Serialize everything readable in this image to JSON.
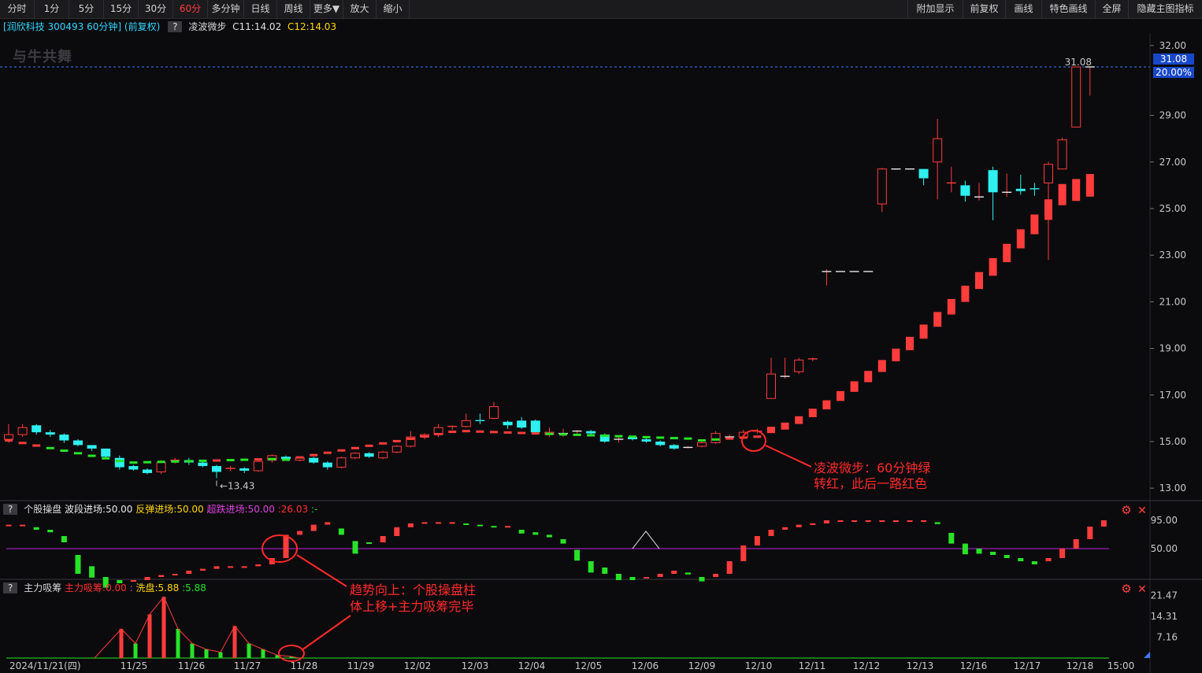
{
  "toolbar": {
    "left": [
      "分时",
      "1分",
      "5分",
      "15分",
      "30分",
      "60分",
      "多分钟",
      "日线",
      "周线",
      "更多▼",
      "放大",
      "缩小"
    ],
    "active": "60分",
    "right": [
      "附加显示",
      "前复权",
      "画线",
      "特色画线",
      "全屏",
      "隐藏主图指标"
    ]
  },
  "info": {
    "stock": "[润欣科技 300493 60分钟]",
    "adjust": "(前复权)",
    "q": "?",
    "indicator": "凌波微步",
    "c1": "C11:14.02",
    "c2": "C12:14.03"
  },
  "watermark": "与牛共舞",
  "panel2": {
    "q": "?",
    "name": "个股操盘",
    "v1": "波段进场:50.00",
    "v2": "反弹进场:50.00",
    "v3": "超跌进场:50.00",
    "v4": ":26.03",
    "v5": ":-"
  },
  "panel3": {
    "q": "?",
    "name": "主力吸筹",
    "v1": "主力吸筹:0.00",
    "v2": ":",
    "v3": "洗盘:5.88",
    "v4": ":5.88"
  },
  "annotations": {
    "a1_line1": "凌波微步：60分钟绿",
    "a1_line2": "转红，此后一路红色",
    "a2_line1": "趋势向上：个股操盘柱",
    "a2_line2": "体上移+主力吸筹完毕"
  },
  "price_tags": {
    "last": "31.08",
    "pct": "20.00%",
    "hi_label": "31.08",
    "lo_label": "13.43"
  },
  "colors": {
    "up": "#ff3c3c",
    "down": "#2ef0f0",
    "green": "#27e327",
    "purple": "#c020e0",
    "accent": "#ff2a2a"
  },
  "chart_data": {
    "type": "candlestick",
    "y_axis_main": [
      13.0,
      15.0,
      17.0,
      19.0,
      21.0,
      23.0,
      25.0,
      27.0,
      29.0,
      31.0,
      32.0
    ],
    "y_axis_labels_main": [
      "13.00",
      "15.00",
      "17.00",
      "19.00",
      "21.00",
      "23.00",
      "25.00",
      "27.00",
      "29.00",
      "32.00"
    ],
    "y_axis_osc": [
      "95.00",
      "50.00"
    ],
    "y_axis_vol": [
      "21.47",
      "14.31",
      "7.16"
    ],
    "x_labels": [
      "2024/11/21(四)",
      "11/25",
      "11/26",
      "11/27",
      "11/28",
      "11/29",
      "12/02",
      "12/03",
      "12/04",
      "12/05",
      "12/06",
      "12/09",
      "12/10",
      "12/11",
      "12/12",
      "12/13",
      "12/16",
      "12/17",
      "12/18",
      "15:00"
    ],
    "ohlc": [
      [
        15.1,
        15.3,
        15.75,
        14.95
      ],
      [
        15.3,
        15.6,
        15.75,
        15.2
      ],
      [
        15.7,
        15.4,
        15.75,
        15.3
      ],
      [
        15.4,
        15.3,
        15.5,
        15.2
      ],
      [
        15.3,
        15.05,
        15.35,
        14.95
      ],
      [
        15.05,
        14.85,
        15.1,
        14.8
      ],
      [
        14.85,
        14.7,
        14.85,
        14.6
      ],
      [
        14.7,
        14.35,
        14.7,
        14.3
      ],
      [
        14.3,
        13.9,
        14.4,
        13.8
      ],
      [
        13.95,
        13.8,
        14.0,
        13.75
      ],
      [
        13.8,
        13.65,
        13.85,
        13.6
      ],
      [
        13.7,
        14.1,
        14.2,
        13.6
      ],
      [
        14.15,
        14.2,
        14.3,
        14.05
      ],
      [
        14.2,
        14.1,
        14.3,
        14.0
      ],
      [
        14.1,
        13.95,
        14.2,
        13.9
      ],
      [
        13.95,
        13.7,
        14.0,
        13.43
      ],
      [
        13.8,
        13.85,
        13.95,
        13.75
      ],
      [
        13.85,
        13.75,
        13.9,
        13.65
      ],
      [
        13.75,
        14.15,
        14.2,
        13.7
      ],
      [
        14.2,
        14.4,
        14.45,
        14.1
      ],
      [
        14.35,
        14.25,
        14.4,
        14.2
      ],
      [
        14.2,
        14.3,
        14.35,
        14.15
      ],
      [
        14.3,
        14.1,
        14.35,
        14.05
      ],
      [
        14.1,
        13.9,
        14.15,
        13.8
      ],
      [
        13.9,
        14.3,
        14.35,
        13.85
      ],
      [
        14.3,
        14.5,
        14.55,
        14.25
      ],
      [
        14.5,
        14.35,
        14.55,
        14.3
      ],
      [
        14.3,
        14.55,
        14.6,
        14.25
      ],
      [
        14.55,
        14.8,
        14.85,
        14.5
      ],
      [
        14.8,
        15.2,
        15.45,
        14.75
      ],
      [
        15.2,
        15.3,
        15.35,
        15.1
      ],
      [
        15.3,
        15.6,
        15.75,
        15.2
      ],
      [
        15.6,
        15.65,
        15.7,
        15.5
      ],
      [
        15.65,
        15.9,
        16.2,
        15.6
      ],
      [
        15.9,
        15.85,
        16.2,
        15.75
      ],
      [
        16.0,
        16.5,
        16.7,
        15.95
      ],
      [
        15.85,
        15.7,
        15.9,
        15.55
      ],
      [
        15.9,
        15.6,
        16.05,
        15.55
      ],
      [
        15.9,
        15.4,
        15.95,
        15.35
      ],
      [
        15.3,
        15.4,
        15.6,
        15.2
      ],
      [
        15.35,
        15.35,
        15.55,
        15.2
      ],
      [
        15.45,
        15.45,
        15.5,
        15.35
      ],
      [
        15.45,
        15.35,
        15.5,
        15.3
      ],
      [
        15.3,
        15.0,
        15.35,
        14.95
      ],
      [
        15.1,
        15.1,
        15.2,
        14.95
      ],
      [
        15.2,
        15.1,
        15.25,
        15.05
      ],
      [
        15.1,
        15.0,
        15.2,
        14.95
      ],
      [
        15.0,
        14.85,
        15.05,
        14.8
      ],
      [
        14.85,
        14.7,
        14.9,
        14.65
      ],
      [
        14.75,
        14.75,
        14.8,
        14.7
      ],
      [
        14.8,
        14.95,
        15.0,
        14.75
      ],
      [
        14.95,
        15.35,
        15.45,
        14.9
      ],
      [
        15.2,
        15.2,
        15.3,
        15.1
      ],
      [
        15.2,
        15.4,
        15.5,
        15.15
      ],
      [
        15.4,
        15.45,
        15.55,
        15.35
      ],
      [
        16.85,
        17.9,
        18.6,
        16.85
      ],
      [
        17.8,
        17.8,
        18.6,
        17.7
      ],
      [
        18.0,
        18.5,
        18.6,
        17.9
      ],
      [
        18.5,
        18.55,
        18.6,
        18.45
      ],
      [
        22.3,
        22.3,
        22.4,
        21.7
      ],
      [
        22.3,
        22.3,
        22.3,
        22.3
      ],
      [
        22.3,
        22.3,
        22.3,
        22.3
      ],
      [
        22.3,
        22.3,
        22.3,
        22.3
      ],
      [
        25.2,
        26.7,
        26.75,
        24.85
      ],
      [
        26.7,
        26.7,
        26.7,
        26.7
      ],
      [
        26.7,
        26.7,
        26.7,
        26.7
      ],
      [
        26.7,
        26.3,
        26.7,
        26.0
      ],
      [
        27.0,
        28.0,
        28.85,
        25.4
      ],
      [
        26.05,
        26.1,
        26.8,
        25.7
      ],
      [
        26.0,
        25.55,
        26.2,
        25.3
      ],
      [
        25.5,
        25.5,
        26.1,
        25.35
      ],
      [
        26.65,
        25.7,
        26.8,
        24.5
      ],
      [
        25.7,
        25.7,
        26.5,
        25.5
      ],
      [
        25.85,
        25.75,
        26.45,
        25.6
      ],
      [
        25.85,
        25.8,
        26.1,
        25.55
      ],
      [
        26.1,
        26.9,
        27.0,
        22.8
      ],
      [
        26.7,
        27.95,
        28.05,
        26.7
      ],
      [
        28.5,
        31.08,
        31.08,
        28.5
      ],
      [
        31.08,
        31.08,
        31.08,
        29.85
      ]
    ]
  }
}
